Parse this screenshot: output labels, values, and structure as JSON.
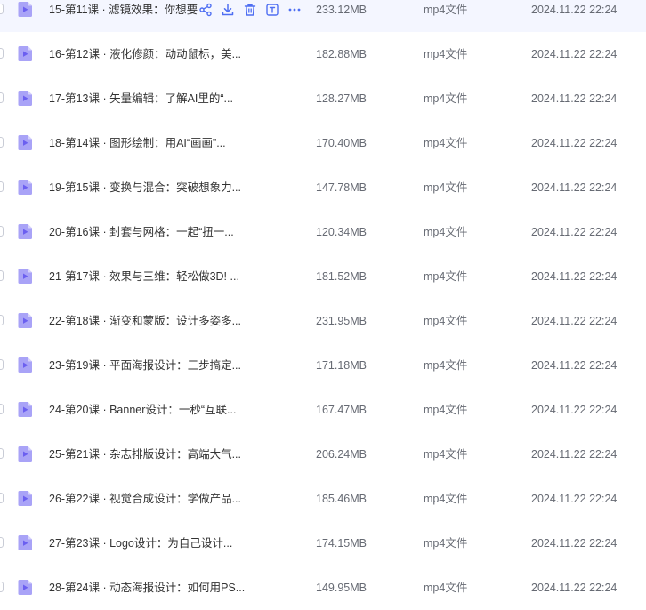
{
  "file_list": {
    "row_icon": "video-file-icon",
    "hover_actions": [
      {
        "name": "share-icon"
      },
      {
        "name": "download-icon"
      },
      {
        "name": "delete-icon"
      },
      {
        "name": "text-icon"
      },
      {
        "name": "more-icon"
      }
    ],
    "colors": {
      "accent": "#4e6ef2",
      "icon_body": "#a9a3f7",
      "icon_fold": "#d7d3fc",
      "icon_play": "#6b5ff0",
      "hover_background": "#f4f6ff"
    },
    "rows": [
      {
        "name": "15-第11课 · 滤镜效果：你想要",
        "size": "233.12MB",
        "type": "mp4文件",
        "date": "2024.11.22  22:24",
        "hovered": true
      },
      {
        "name": "16-第12课 · 液化修颜：动动鼠标，美...",
        "size": "182.88MB",
        "type": "mp4文件",
        "date": "2024.11.22  22:24"
      },
      {
        "name": "17-第13课 · 矢量编辑：了解AI里的“...",
        "size": "128.27MB",
        "type": "mp4文件",
        "date": "2024.11.22  22:24"
      },
      {
        "name": "18-第14课 · 图形绘制：用AI“画画”...",
        "size": "170.40MB",
        "type": "mp4文件",
        "date": "2024.11.22  22:24"
      },
      {
        "name": "19-第15课 · 变换与混合：突破想象力...",
        "size": "147.78MB",
        "type": "mp4文件",
        "date": "2024.11.22  22:24"
      },
      {
        "name": "20-第16课 · 封套与网格：一起“扭一...",
        "size": "120.34MB",
        "type": "mp4文件",
        "date": "2024.11.22  22:24"
      },
      {
        "name": "21-第17课 · 效果与三维：轻松做3D! ...",
        "size": "181.52MB",
        "type": "mp4文件",
        "date": "2024.11.22  22:24"
      },
      {
        "name": "22-第18课 · 渐变和蒙版：设计多姿多...",
        "size": "231.95MB",
        "type": "mp4文件",
        "date": "2024.11.22  22:24"
      },
      {
        "name": "23-第19课 · 平面海报设计：三步搞定...",
        "size": "171.18MB",
        "type": "mp4文件",
        "date": "2024.11.22  22:24"
      },
      {
        "name": "24-第20课 · Banner设计：一秒“互联...",
        "size": "167.47MB",
        "type": "mp4文件",
        "date": "2024.11.22  22:24"
      },
      {
        "name": "25-第21课 · 杂志排版设计：高端大气...",
        "size": "206.24MB",
        "type": "mp4文件",
        "date": "2024.11.22  22:24"
      },
      {
        "name": "26-第22课 · 视觉合成设计：学做产品...",
        "size": "185.46MB",
        "type": "mp4文件",
        "date": "2024.11.22  22:24"
      },
      {
        "name": "27-第23课 · Logo设计：为自己设计...",
        "size": "174.15MB",
        "type": "mp4文件",
        "date": "2024.11.22  22:24"
      },
      {
        "name": "28-第24课 · 动态海报设计：如何用PS...",
        "size": "149.95MB",
        "type": "mp4文件",
        "date": "2024.11.22  22:24"
      }
    ]
  }
}
